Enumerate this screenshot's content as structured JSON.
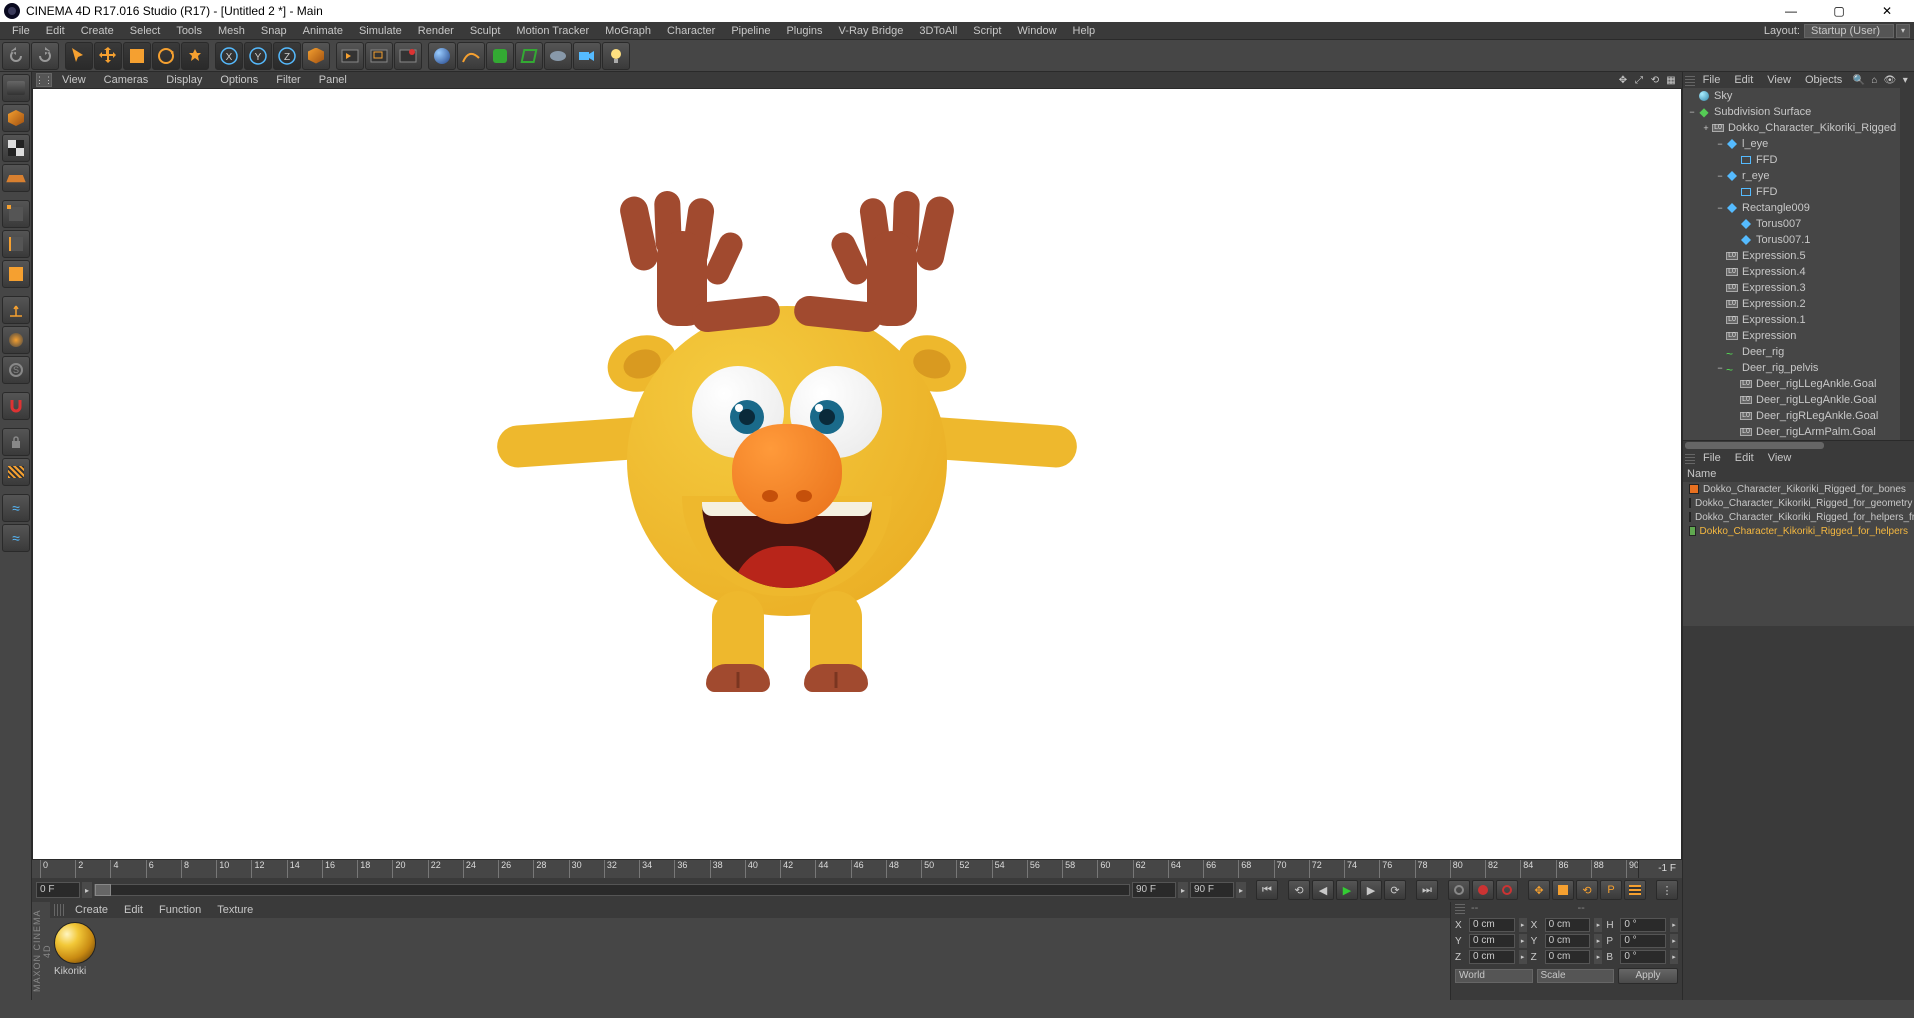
{
  "titlebar": {
    "title": "CINEMA 4D R17.016 Studio (R17) - [Untitled 2 *] - Main"
  },
  "menu": {
    "items": [
      "File",
      "Edit",
      "Create",
      "Select",
      "Tools",
      "Mesh",
      "Snap",
      "Animate",
      "Simulate",
      "Render",
      "Sculpt",
      "Motion Tracker",
      "MoGraph",
      "Character",
      "Pipeline",
      "Plugins",
      "V-Ray Bridge",
      "3DToAll",
      "Script",
      "Window",
      "Help"
    ],
    "layout_label": "Layout:",
    "layout_value": "Startup (User)"
  },
  "viewmenu": {
    "items": [
      "View",
      "Cameras",
      "Display",
      "Options",
      "Filter",
      "Panel"
    ]
  },
  "timeline": {
    "ticks": [
      "0",
      "2",
      "4",
      "6",
      "8",
      "10",
      "12",
      "14",
      "16",
      "18",
      "20",
      "22",
      "24",
      "26",
      "28",
      "30",
      "32",
      "34",
      "36",
      "38",
      "40",
      "42",
      "44",
      "46",
      "48",
      "50",
      "52",
      "54",
      "56",
      "58",
      "60",
      "62",
      "64",
      "66",
      "68",
      "70",
      "72",
      "74",
      "76",
      "78",
      "80",
      "82",
      "84",
      "86",
      "88",
      "90"
    ],
    "end_label": "-1 F",
    "start_field": "0 F",
    "scrub_field": "0 F",
    "range_a": "90 F",
    "range_b": "90 F"
  },
  "materials": {
    "menu": [
      "Create",
      "Edit",
      "Function",
      "Texture"
    ],
    "thumb_label": "Kikoriki"
  },
  "maxon_label": "MAXON CINEMA 4D",
  "objects_panel": {
    "menu": [
      "File",
      "Edit",
      "View",
      "Objects"
    ],
    "tree": [
      {
        "d": 0,
        "exp": "",
        "icon": "sky",
        "label": "Sky"
      },
      {
        "d": 0,
        "exp": "−",
        "icon": "sds",
        "label": "Subdivision Surface"
      },
      {
        "d": 1,
        "exp": "+",
        "icon": "null",
        "label": "Dokko_Character_Kikoriki_Rigged"
      },
      {
        "d": 2,
        "exp": "−",
        "icon": "joint",
        "label": "l_eye"
      },
      {
        "d": 3,
        "exp": "",
        "icon": "ffd",
        "label": "FFD"
      },
      {
        "d": 2,
        "exp": "−",
        "icon": "joint",
        "label": "r_eye"
      },
      {
        "d": 3,
        "exp": "",
        "icon": "ffd",
        "label": "FFD"
      },
      {
        "d": 2,
        "exp": "−",
        "icon": "joint",
        "label": "Rectangle009"
      },
      {
        "d": 3,
        "exp": "",
        "icon": "joint",
        "label": "Torus007"
      },
      {
        "d": 3,
        "exp": "",
        "icon": "joint",
        "label": "Torus007.1"
      },
      {
        "d": 2,
        "exp": "",
        "icon": "null",
        "label": "Expression.5"
      },
      {
        "d": 2,
        "exp": "",
        "icon": "null",
        "label": "Expression.4"
      },
      {
        "d": 2,
        "exp": "",
        "icon": "null",
        "label": "Expression.3"
      },
      {
        "d": 2,
        "exp": "",
        "icon": "null",
        "label": "Expression.2"
      },
      {
        "d": 2,
        "exp": "",
        "icon": "null",
        "label": "Expression.1"
      },
      {
        "d": 2,
        "exp": "",
        "icon": "null",
        "label": "Expression"
      },
      {
        "d": 2,
        "exp": "",
        "icon": "spline",
        "label": "Deer_rig"
      },
      {
        "d": 2,
        "exp": "−",
        "icon": "spline",
        "label": "Deer_rig_pelvis"
      },
      {
        "d": 3,
        "exp": "",
        "icon": "null",
        "label": "Deer_rigLLegAnkle.Goal"
      },
      {
        "d": 3,
        "exp": "",
        "icon": "null",
        "label": "Deer_rigLLegAnkle.Goal"
      },
      {
        "d": 3,
        "exp": "",
        "icon": "null",
        "label": "Deer_rigRLegAnkle.Goal"
      },
      {
        "d": 3,
        "exp": "",
        "icon": "null",
        "label": "Deer_rigLArmPalm.Goal"
      }
    ]
  },
  "layers_panel": {
    "menu": [
      "File",
      "Edit",
      "View"
    ],
    "header": "Name",
    "rows": [
      {
        "color": "#e87020",
        "label": "Dokko_Character_Kikoriki_Rigged_for_bones",
        "sel": false
      },
      {
        "color": "#d8c830",
        "label": "Dokko_Character_Kikoriki_Rigged_for_geometry",
        "sel": false
      },
      {
        "color": "#2040c0",
        "label": "Dokko_Character_Kikoriki_Rigged_for_helpers_fr",
        "sel": false
      },
      {
        "color": "#60a850",
        "label": "Dokko_Character_Kikoriki_Rigged_for_helpers",
        "sel": true
      }
    ]
  },
  "coords": {
    "rows": [
      {
        "a": "X",
        "av": "0 cm",
        "b": "X",
        "bv": "0 cm",
        "c": "H",
        "cv": "0 °"
      },
      {
        "a": "Y",
        "av": "0 cm",
        "b": "Y",
        "bv": "0 cm",
        "c": "P",
        "cv": "0 °"
      },
      {
        "a": "Z",
        "av": "0 cm",
        "b": "Z",
        "bv": "0 cm",
        "c": "B",
        "cv": "0 °"
      }
    ],
    "sel_a": "World",
    "sel_b": "Scale",
    "apply": "Apply"
  }
}
